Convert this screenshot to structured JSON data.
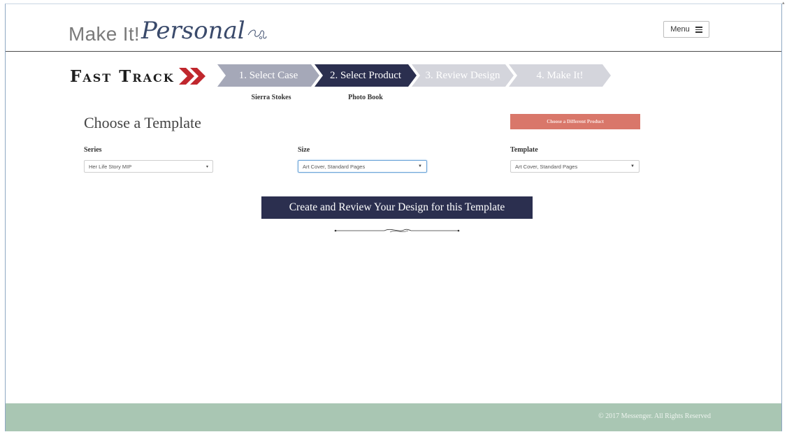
{
  "header": {
    "logo_make": "Make It!",
    "logo_personal": "Personal",
    "menu_label": "Menu"
  },
  "fast_track": {
    "title": "Fast Track",
    "steps": [
      {
        "label": "1. Select Case",
        "sub": "Sierra Stokes",
        "state": "done",
        "color": "#a5a8b8"
      },
      {
        "label": "2. Select Product",
        "sub": "Photo Book",
        "state": "active",
        "color": "#2b2f4f"
      },
      {
        "label": "3. Review Design",
        "sub": "",
        "state": "pending",
        "color": "#d4d5dc"
      },
      {
        "label": "4. Make It!",
        "sub": "",
        "state": "pending",
        "color": "#d4d5dc"
      }
    ],
    "accent_color": "#c0272d"
  },
  "main": {
    "title": "Choose a Template",
    "different_product_button": "Choose a Different Product",
    "fields": {
      "series": {
        "label": "Series",
        "value": "Her Life Story MIP"
      },
      "size": {
        "label": "Size",
        "value": "Art Cover, Standard Pages"
      },
      "template": {
        "label": "Template",
        "value": "Art Cover, Standard Pages"
      }
    },
    "create_button": "Create and Review Your Design for this Template"
  },
  "footer": {
    "copyright": "© 2017 Messenger. All Rights Reserved",
    "color": "#a9c6b3"
  }
}
